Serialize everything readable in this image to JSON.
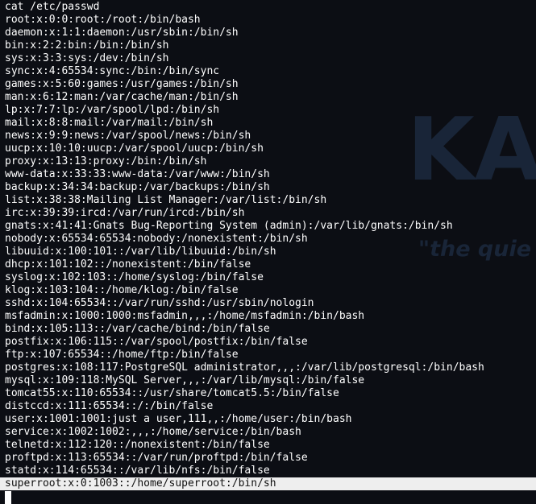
{
  "terminal": {
    "command": "cat /etc/passwd",
    "lines": [
      "root:x:0:0:root:/root:/bin/bash",
      "daemon:x:1:1:daemon:/usr/sbin:/bin/sh",
      "bin:x:2:2:bin:/bin:/bin/sh",
      "sys:x:3:3:sys:/dev:/bin/sh",
      "sync:x:4:65534:sync:/bin:/bin/sync",
      "games:x:5:60:games:/usr/games:/bin/sh",
      "man:x:6:12:man:/var/cache/man:/bin/sh",
      "lp:x:7:7:lp:/var/spool/lpd:/bin/sh",
      "mail:x:8:8:mail:/var/mail:/bin/sh",
      "news:x:9:9:news:/var/spool/news:/bin/sh",
      "uucp:x:10:10:uucp:/var/spool/uucp:/bin/sh",
      "proxy:x:13:13:proxy:/bin:/bin/sh",
      "www-data:x:33:33:www-data:/var/www:/bin/sh",
      "backup:x:34:34:backup:/var/backups:/bin/sh",
      "list:x:38:38:Mailing List Manager:/var/list:/bin/sh",
      "irc:x:39:39:ircd:/var/run/ircd:/bin/sh",
      "gnats:x:41:41:Gnats Bug-Reporting System (admin):/var/lib/gnats:/bin/sh",
      "nobody:x:65534:65534:nobody:/nonexistent:/bin/sh",
      "libuuid:x:100:101::/var/lib/libuuid:/bin/sh",
      "dhcp:x:101:102::/nonexistent:/bin/false",
      "syslog:x:102:103::/home/syslog:/bin/false",
      "klog:x:103:104::/home/klog:/bin/false",
      "sshd:x:104:65534::/var/run/sshd:/usr/sbin/nologin",
      "msfadmin:x:1000:1000:msfadmin,,,:/home/msfadmin:/bin/bash",
      "bind:x:105:113::/var/cache/bind:/bin/false",
      "postfix:x:106:115::/var/spool/postfix:/bin/false",
      "ftp:x:107:65534::/home/ftp:/bin/false",
      "postgres:x:108:117:PostgreSQL administrator,,,:/var/lib/postgresql:/bin/bash",
      "mysql:x:109:118:MySQL Server,,,:/var/lib/mysql:/bin/false",
      "tomcat55:x:110:65534::/usr/share/tomcat5.5:/bin/false",
      "distccd:x:111:65534::/:/bin/false",
      "user:x:1001:1001:just a user,111,,:/home/user:/bin/bash",
      "service:x:1002:1002:,,,:/home/service:/bin/bash",
      "telnetd:x:112:120::/nonexistent:/bin/false",
      "proftpd:x:113:65534::/var/run/proftpd:/bin/false",
      "statd:x:114:65534::/var/lib/nfs:/bin/false"
    ],
    "selected_line": "superroot:x:0:1003::/home/superroot:/bin/sh"
  },
  "wallpaper": {
    "logo_text": "KA",
    "tagline": "\"the quie"
  },
  "colors": {
    "background": "#0c0e14",
    "text": "#ffffff",
    "selection": "#eeeeee",
    "wallpaper_logo": "#1c2a3f"
  }
}
